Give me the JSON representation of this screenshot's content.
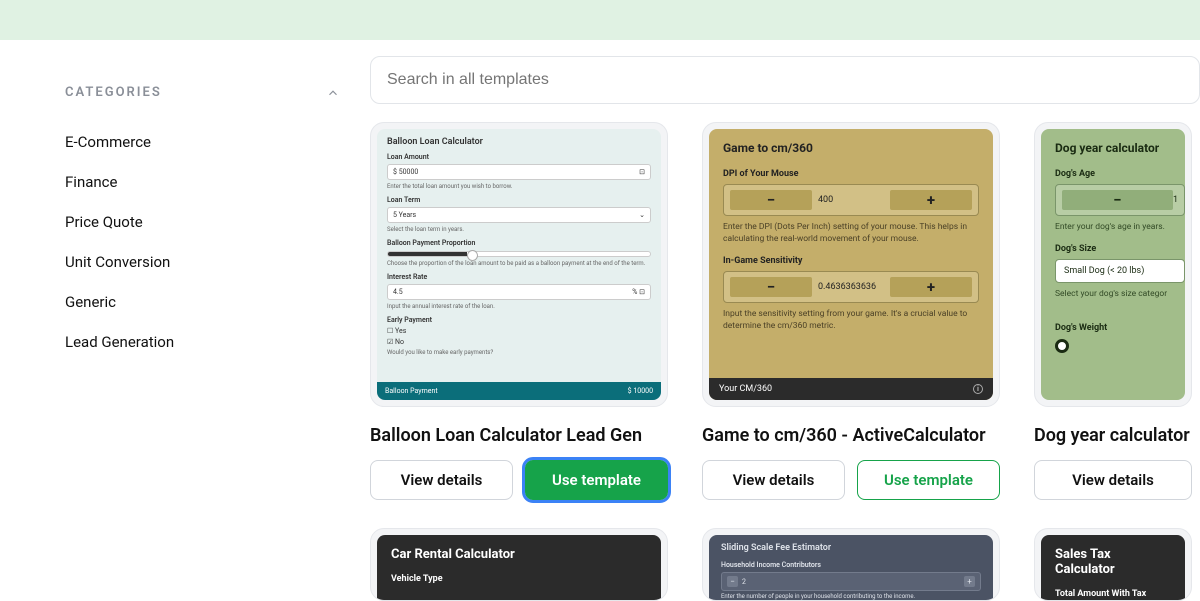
{
  "sidebar": {
    "heading": "CATEGORIES",
    "items": [
      "E-Commerce",
      "Finance",
      "Price Quote",
      "Unit Conversion",
      "Generic",
      "Lead Generation"
    ]
  },
  "search": {
    "placeholder": "Search in all templates"
  },
  "templates": [
    {
      "title": "Balloon Loan Calculator Lead Gen",
      "view_label": "View details",
      "use_label": "Use template",
      "preview": {
        "heading": "Balloon Loan Calculator",
        "f1_label": "Loan Amount",
        "f1_prefix": "$",
        "f1_value": "50000",
        "f1_help": "Enter the total loan amount you wish to borrow.",
        "f2_label": "Loan Term",
        "f2_value": "5 Years",
        "f2_help": "Select the loan term in years.",
        "f3_label": "Balloon Payment Proportion",
        "f3_help": "Choose the proportion of the loan amount to be paid as a balloon payment at the end of the term.",
        "f4_label": "Interest Rate",
        "f4_value": "4.5",
        "f4_suffix": "%",
        "f4_help": "Input the annual interest rate of the loan.",
        "f5_label": "Early Payment",
        "f5_opt1": "Yes",
        "f5_opt2": "No",
        "f5_help": "Would you like to make early payments?",
        "foot_label": "Balloon Payment",
        "foot_value": "$ 10000"
      }
    },
    {
      "title": "Game to cm/360 - ActiveCalculator",
      "view_label": "View details",
      "use_label": "Use template",
      "preview": {
        "heading": "Game to cm/360",
        "f1_label": "DPI of Your Mouse",
        "f1_value": "400",
        "f1_help": "Enter the DPI (Dots Per Inch) setting of your mouse. This helps in calculating the real-world movement of your mouse.",
        "f2_label": "In-Game Sensitivity",
        "f2_value": "0.4636363636",
        "f2_help": "Input the sensitivity setting from your game. It's a crucial value to determine the cm/360 metric.",
        "foot_label": "Your CM/360"
      }
    },
    {
      "title": "Dog year calculator",
      "view_label": "View details",
      "preview": {
        "heading": "Dog year calculator",
        "f1_label": "Dog's Age",
        "f1_value": "1",
        "f1_help": "Enter your dog's age in years.",
        "f2_label": "Dog's Size",
        "f2_value": "Small Dog (< 20 lbs)",
        "f2_help": "Select your dog's size categor",
        "f3_label": "Dog's Weight"
      }
    }
  ],
  "row2": [
    {
      "heading": "Car Rental Calculator",
      "f1_label": "Vehicle Type"
    },
    {
      "heading": "Sliding Scale Fee Estimator",
      "f1_label": "Household Income Contributors",
      "f1_value": "2",
      "f1_help": "Enter the number of people in your household contributing to the income."
    },
    {
      "heading": "Sales Tax Calculator",
      "f1_label": "Total Amount With Tax"
    }
  ]
}
